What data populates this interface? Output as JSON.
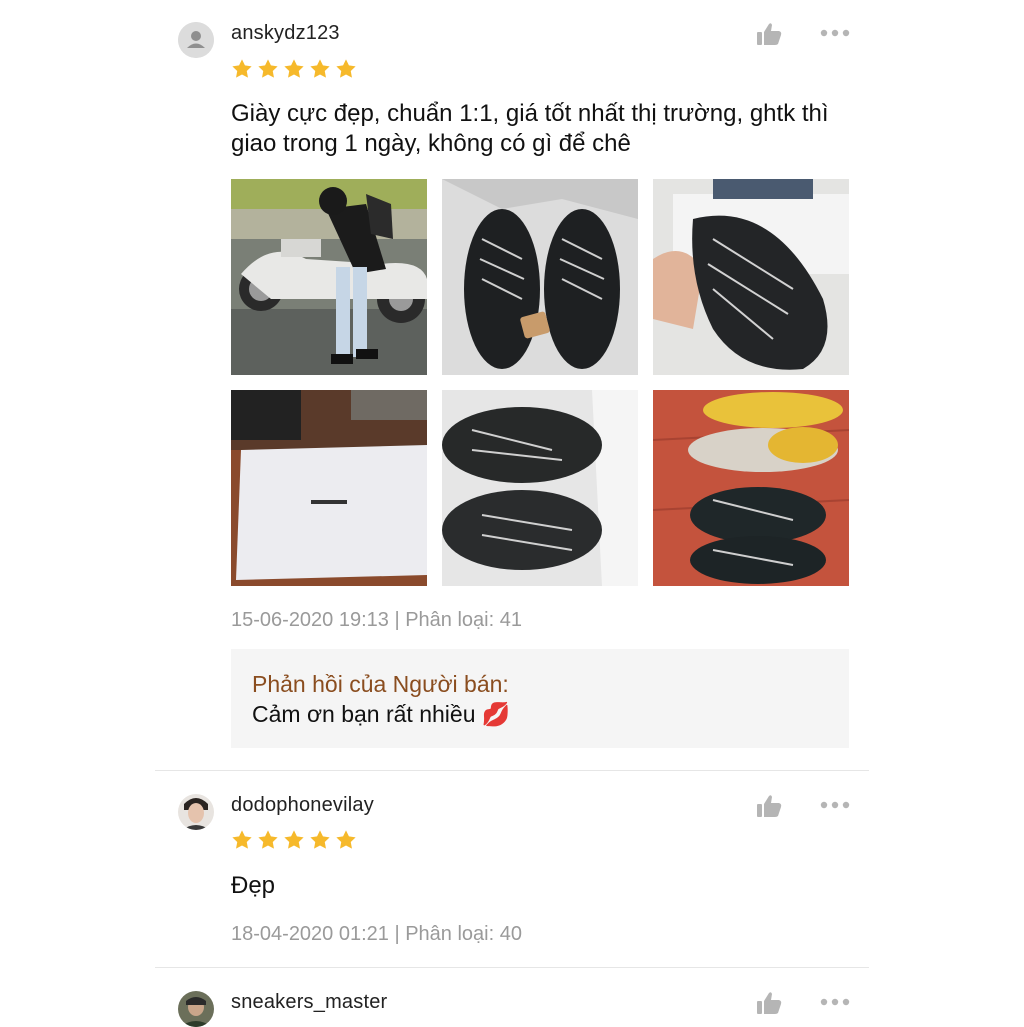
{
  "reviews": [
    {
      "username": "anskydz123",
      "rating": 5,
      "comment_line1": "Giày cực đẹp, chuẩn 1:1, giá tốt nhất thị trường, ghtk thì",
      "comment_line2": "giao trong 1 ngày, không có gì để chê",
      "meta": "15-06-2020 19:13 | Phân loại: 41",
      "seller_reply": {
        "title": "Phản hồi của Người bán:",
        "text": "Cảm ơn bạn rất nhiều 💋"
      }
    },
    {
      "username": "dodophonevilay",
      "rating": 5,
      "comment": "Đẹp",
      "meta": "18-04-2020 01:21 | Phân loại: 40"
    },
    {
      "username": "sneakers_master"
    }
  ],
  "icons": {
    "like": "thumbs-up-icon",
    "more": "more-dots-icon",
    "star": "star-icon"
  },
  "colors": {
    "star": "#f6b92b",
    "icon_gray": "#b5b5b5",
    "reply_title": "#8a4d1f",
    "meta_text": "#9a9a9a"
  }
}
